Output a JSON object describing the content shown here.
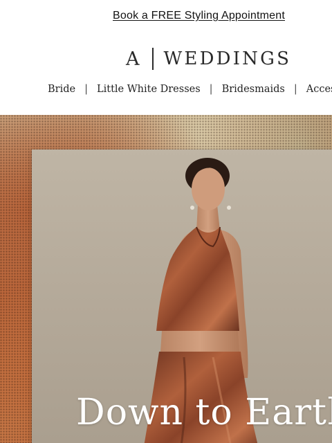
{
  "promo": {
    "link_text": "Book a FREE Styling Appointment"
  },
  "brand": {
    "letter": "A",
    "name": "WEDDINGS"
  },
  "nav": {
    "items": [
      {
        "label": "Bride"
      },
      {
        "label": "Little White Dresses"
      },
      {
        "label": "Bridesmaids"
      },
      {
        "label": "Accessories"
      }
    ],
    "separator": "|"
  },
  "hero": {
    "title": "Down to Earth",
    "image_description": "model-in-rust-satin-halter-top-and-skirt"
  },
  "colors": {
    "text": "#111111",
    "dress": "#8e4a2c",
    "backdrop": "#b3a898",
    "hero_texture": "#b9673c",
    "hero_title": "#ffffff"
  }
}
